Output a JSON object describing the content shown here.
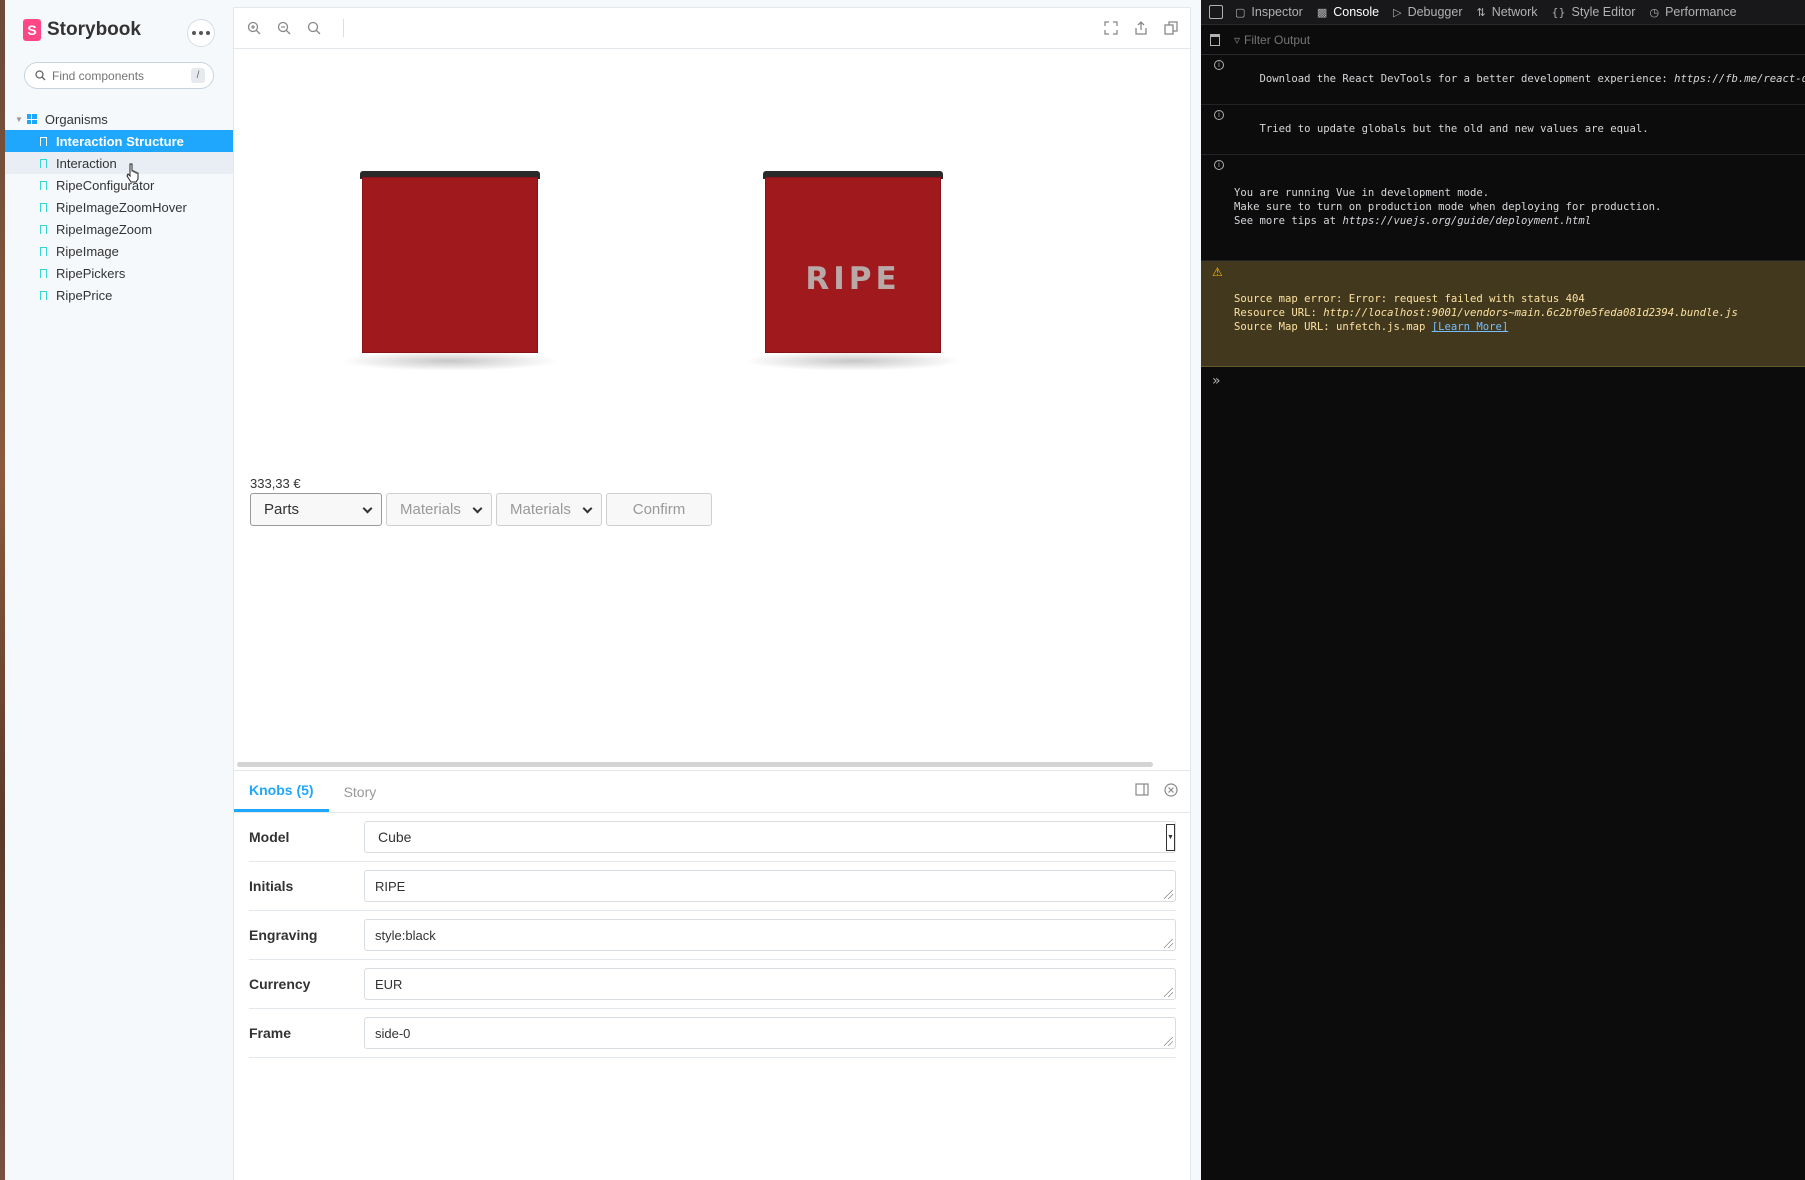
{
  "sidebar": {
    "brand": "Storybook",
    "search_placeholder": "Find components",
    "search_shortcut": "/",
    "group": "Organisms",
    "stories": [
      {
        "label": "Interaction Structure",
        "state": "active"
      },
      {
        "label": "Interaction",
        "state": "hover"
      },
      {
        "label": "RipeConfigurator",
        "state": ""
      },
      {
        "label": "RipeImageZoomHover",
        "state": ""
      },
      {
        "label": "RipeImageZoom",
        "state": ""
      },
      {
        "label": "RipeImage",
        "state": ""
      },
      {
        "label": "RipePickers",
        "state": ""
      },
      {
        "label": "RipePrice",
        "state": ""
      }
    ]
  },
  "preview": {
    "cube_initials": "RIPE",
    "price": "333,33 €",
    "controls": {
      "parts": "Parts",
      "materials_1": "Materials",
      "materials_2": "Materials",
      "confirm": "Confirm"
    }
  },
  "addon": {
    "tabs": [
      "Knobs (5)",
      "Story"
    ],
    "knobs": [
      {
        "label": "Model",
        "value": "Cube"
      },
      {
        "label": "Initials",
        "value": "RIPE"
      },
      {
        "label": "Engraving",
        "value": "style:black"
      },
      {
        "label": "Currency",
        "value": "EUR"
      },
      {
        "label": "Frame",
        "value": "side-0"
      }
    ]
  },
  "devtools": {
    "tabs": [
      "Inspector",
      "Console",
      "Debugger",
      "Network",
      "Style Editor",
      "Performance"
    ],
    "active_tab": "Console",
    "filter_placeholder": "Filter Output",
    "messages": {
      "m1_text": "Download the React DevTools for a better development experience: ",
      "m1_link": "https://fb.me/react-devtools",
      "m2": "Tried to update globals but the old and new values are equal.",
      "m3_l1": "You are running Vue in development mode.",
      "m3_l2": "Make sure to turn on production mode when deploying for production.",
      "m3_l3_text": "See more tips at ",
      "m3_l3_link": "https://vuejs.org/guide/deployment.html",
      "w_l1": "Source map error: Error: request failed with status 404",
      "w_l2_text": "Resource URL: ",
      "w_l2_link": "http://localhost:9001/vendors~main.6c2bf0e5feda081d2394.bundle.js",
      "w_l3_text": "Source Map URL: unfetch.js.map ",
      "w_l3_link": "[Learn More]"
    }
  },
  "colors": {
    "accent": "#1ea7fd",
    "brand": "#ff4785",
    "cube": "#a0191d"
  }
}
